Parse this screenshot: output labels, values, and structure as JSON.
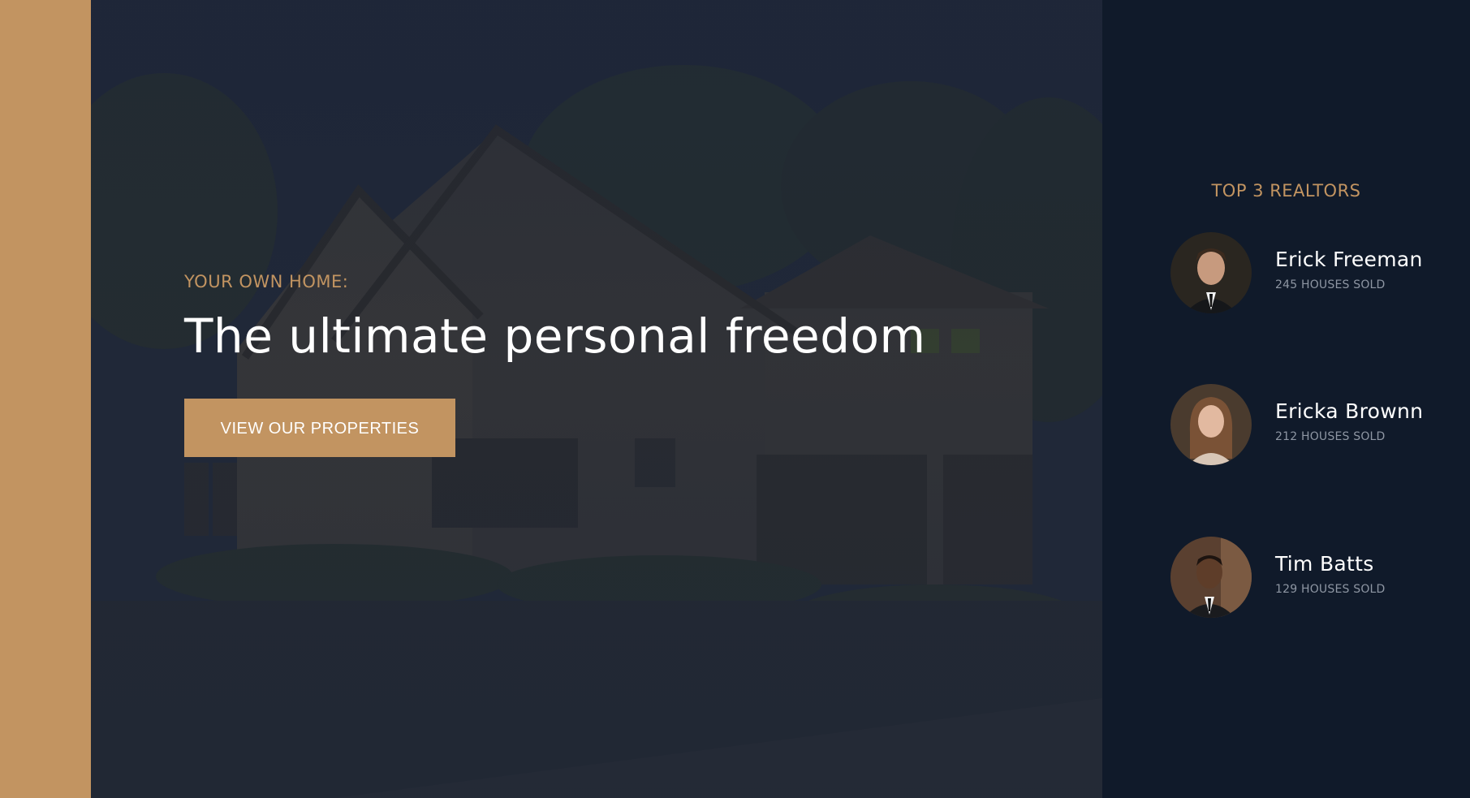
{
  "colors": {
    "accent": "#c29461",
    "panel": "#101a2a",
    "hero_overlay": "#1f2738",
    "text": "#ffffff",
    "muted": "#8e96a3"
  },
  "hero": {
    "kicker": "YOUR OWN HOME:",
    "title": "The ultimate personal freedom",
    "button_label": "VIEW OUR PROPERTIES"
  },
  "realtors": {
    "title": "TOP 3 REALTORS",
    "items": [
      {
        "name": "Erick Freeman",
        "sold": "245 HOUSES SOLD",
        "avatar": "man-suit-photo"
      },
      {
        "name": "Ericka Brownn",
        "sold": "212 HOUSES SOLD",
        "avatar": "woman-photo"
      },
      {
        "name": "Tim Batts",
        "sold": "129 HOUSES SOLD",
        "avatar": "man-suit-photo"
      }
    ]
  }
}
